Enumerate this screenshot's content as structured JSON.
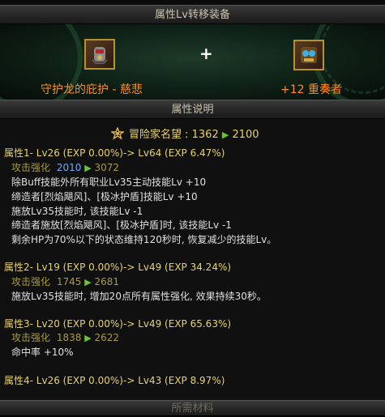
{
  "header_top": "属性Lv转移装备",
  "header_mid": "属性说明",
  "header_bottom": "所需材料",
  "items": {
    "left": {
      "name": "守护龙的庇护 - 慈悲",
      "icon": "dragon-gauntlet-icon"
    },
    "plus": "+",
    "right": {
      "name": "+12 重奏者",
      "icon": "ornate-armor-icon"
    }
  },
  "reputation": {
    "label": "冒险家名望 : 1362",
    "to": "2100",
    "icon": "emblem-icon"
  },
  "attributes": [
    {
      "title": "属性1- Lv26 (EXP 0.00%)-> Lv64 (EXP 6.47%)",
      "stat_label": "攻击强化",
      "stat_from": "2010",
      "stat_to": "3072",
      "lines": [
        "除Buff技能外所有职业Lv35主动技能Lv +10",
        "缔造者[烈焰飓风]、[极冰护盾]技能Lv +10",
        "施放Lv35技能时, 该技能Lv -1",
        "缔造者施放[烈焰飓风]、[极冰护盾]时, 该技能Lv -1",
        "剩余HP为70%以下的状态维持120秒时, 恢复减少的技能Lv。"
      ]
    },
    {
      "title": "属性2- Lv19 (EXP 0.00%)-> Lv49 (EXP 34.24%)",
      "stat_label": "攻击强化",
      "stat_from": "1745",
      "stat_to": "2681",
      "lines": [
        "施放Lv35技能时, 增加20点所有属性强化, 效果持续30秒。"
      ]
    },
    {
      "title": "属性3- Lv20 (EXP 0.00%)-> Lv49 (EXP 65.63%)",
      "stat_label": "攻击强化",
      "stat_from": "1838",
      "stat_to": "2622",
      "lines": [
        "命中率 +10%"
      ]
    },
    {
      "title": "属性4- Lv26 (EXP 0.00%)-> Lv43 (EXP 8.97%)"
    }
  ],
  "arrow_glyph": "▶"
}
